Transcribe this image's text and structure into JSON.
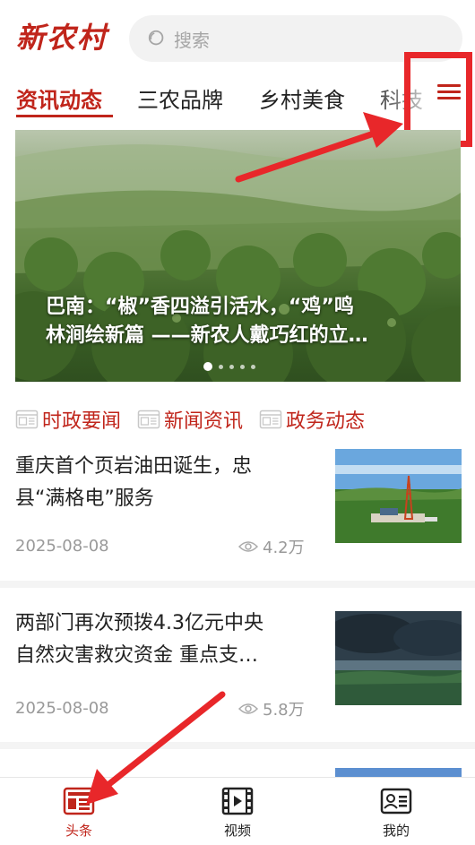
{
  "header": {
    "logo_text": "新农村",
    "search": {
      "placeholder": "搜索"
    }
  },
  "tabs": [
    {
      "label": "资讯动态",
      "active": true
    },
    {
      "label": "三农品牌",
      "active": false
    },
    {
      "label": "乡村美食",
      "active": false
    },
    {
      "label": "科技",
      "active": false
    }
  ],
  "banner": {
    "title_line1": "巴南：“椒”香四溢引活水，“鸡”鸣",
    "title_line2": "林涧绘新篇 ——新农人戴巧红的立…",
    "dots_count": 5,
    "active_dot": 0
  },
  "categories": [
    {
      "label": "时政要闻",
      "icon": "news-doc-icon"
    },
    {
      "label": "新闻资讯",
      "icon": "news-doc-icon"
    },
    {
      "label": "政务动态",
      "icon": "news-doc-icon"
    }
  ],
  "news": [
    {
      "title_line1": "重庆首个页岩油田诞生，忠",
      "title_line2": "县“满格电”服务",
      "date": "2025-08-08",
      "views": "4.2万",
      "thumb": "oil-field-photo"
    },
    {
      "title_line1": "两部门再次预拨4.3亿元中央",
      "title_line2": "自然灾害救灾资金 重点支…",
      "date": "2025-08-08",
      "views": "5.8万",
      "thumb": "storm-clouds-photo"
    }
  ],
  "tabbar": [
    {
      "label": "头条",
      "icon": "headline-icon",
      "active": true
    },
    {
      "label": "视频",
      "icon": "video-icon",
      "active": false
    },
    {
      "label": "我的",
      "icon": "profile-card-icon",
      "active": false
    }
  ],
  "colors": {
    "accent": "#c0251b",
    "annotation_red": "#e8272a",
    "muted": "#999999"
  }
}
